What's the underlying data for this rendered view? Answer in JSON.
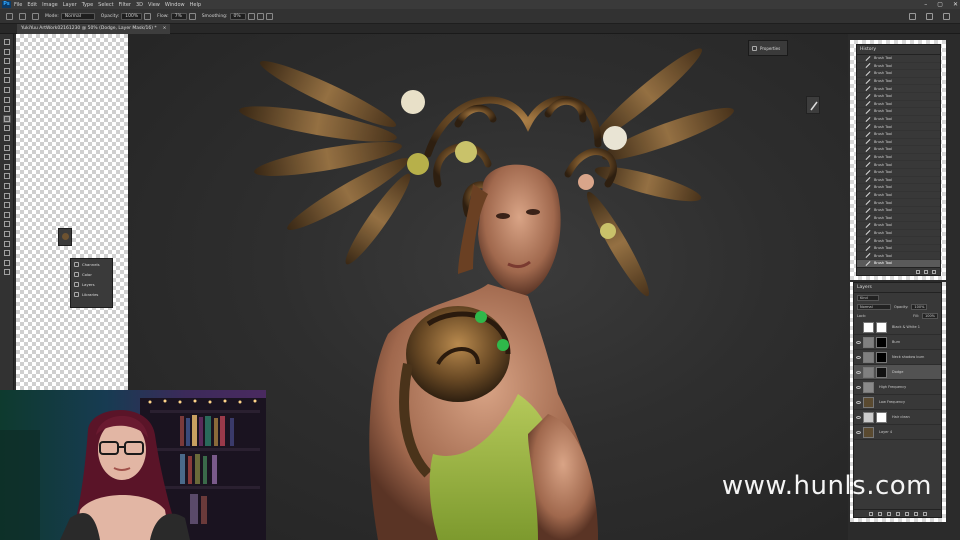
{
  "app": {
    "logo": "Ps"
  },
  "menu": [
    "File",
    "Edit",
    "Image",
    "Layer",
    "Type",
    "Select",
    "Filter",
    "3D",
    "View",
    "Window",
    "Help"
  ],
  "window_controls": [
    "–",
    "▢",
    "✕"
  ],
  "options_bar": {
    "mode_label": "Mode:",
    "mode_value": "Normal",
    "opacity_label": "Opacity:",
    "opacity_value": "100%",
    "flow_label": "Flow:",
    "flow_value": "7%",
    "smoothing_label": "Smoothing:",
    "smoothing_value": "0%"
  },
  "document_tab": {
    "title": "YukiYuu ArtWork02161230 @ 50% (Dodge, Layer Mask/16) *",
    "close": "×"
  },
  "floating_panel": {
    "items": [
      {
        "label": "Channels",
        "icon": "channels-icon"
      },
      {
        "label": "Color",
        "icon": "color-icon"
      },
      {
        "label": "Layers",
        "icon": "layers-icon"
      },
      {
        "label": "Libraries",
        "icon": "libraries-icon"
      }
    ]
  },
  "properties_button": {
    "label": "Properties"
  },
  "history": {
    "title": "History",
    "item_label": "Brush Tool",
    "item_count": 28,
    "selected_index": 27
  },
  "layers": {
    "title": "Layers",
    "kind_label": "Kind",
    "blend_mode": "Normal",
    "opacity_label": "Opacity:",
    "opacity_value": "100%",
    "lock_label": "Lock:",
    "fill_label": "Fill:",
    "fill_value": "100%",
    "items": [
      {
        "name": "Black & White 1",
        "visible": false,
        "thumb_color": "#ffffff",
        "mask_color": "#ffffff",
        "selected": false
      },
      {
        "name": "Burn",
        "visible": true,
        "thumb_color": "#808080",
        "mask_color": "#000000",
        "selected": false
      },
      {
        "name": "Neck shadow burn",
        "visible": true,
        "thumb_color": "#808080",
        "mask_color": "#000000",
        "selected": false
      },
      {
        "name": "Dodge",
        "visible": true,
        "thumb_color": "#808080",
        "mask_color": "#111111",
        "selected": true
      },
      {
        "name": "High Frequency",
        "visible": true,
        "thumb_color": "#8a8a8a",
        "mask_color": null,
        "selected": false
      },
      {
        "name": "Low Frequency",
        "visible": true,
        "thumb_color": "#5a4a30",
        "mask_color": null,
        "selected": false
      },
      {
        "name": "Hair clean",
        "visible": true,
        "thumb_color": "#cccccc",
        "mask_color": "#ffffff",
        "selected": false
      },
      {
        "name": "Layer 4",
        "visible": true,
        "thumb_color": "#5a4a30",
        "mask_color": null,
        "selected": false
      }
    ]
  },
  "watermark": {
    "text": "www.hunls.com"
  },
  "colors": {
    "accent": "#31a8ff",
    "panel": "#383838",
    "bar": "#323232"
  }
}
